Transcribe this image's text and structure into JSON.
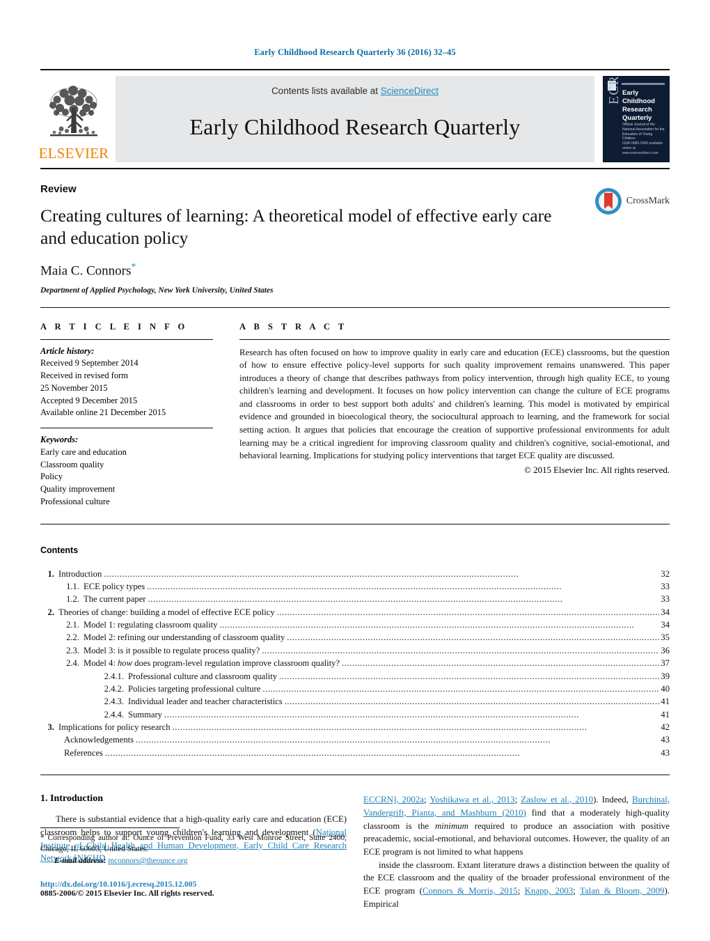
{
  "running_head": "Early Childhood Research Quarterly 36 (2016) 32–45",
  "banner": {
    "publisher_name": "ELSEVIER",
    "contents_prefix": "Contents lists available at ",
    "sciencedirect": "ScienceDirect",
    "journal_title": "Early Childhood Research Quarterly",
    "cover": {
      "title": "Early Childhood Research Quarterly",
      "subtitle": "Official Journal of the National Association for the Education of Young Children",
      "mark": "ECRQ",
      "footer": "ISSN 0885-2006  available online at www.sciencedirect.com"
    }
  },
  "article": {
    "type": "Review",
    "title": "Creating cultures of learning: A theoretical model of effective early care and education policy",
    "author": "Maia C. Connors",
    "author_marker": "*",
    "affiliation": "Department of Applied Psychology, New York University, United States",
    "crossmark_label": "CrossMark"
  },
  "info": {
    "heading": "A R T I C L E   I N F O",
    "history_head": "Article history:",
    "history": [
      "Received 9 September 2014",
      "Received in revised form",
      "25 November 2015",
      "Accepted 9 December 2015",
      "Available online 21 December 2015"
    ],
    "keywords_head": "Keywords:",
    "keywords": [
      "Early care and education",
      "Classroom quality",
      "Policy",
      "Quality improvement",
      "Professional culture"
    ]
  },
  "abstract": {
    "heading": "A B S T R A C T",
    "text": "Research has often focused on how to improve quality in early care and education (ECE) classrooms, but the question of how to ensure effective policy-level supports for such quality improvement remains unanswered. This paper introduces a theory of change that describes pathways from policy intervention, through high quality ECE, to young children's learning and development. It focuses on how policy intervention can change the culture of ECE programs and classrooms in order to best support both adults' and children's learning. This model is motivated by empirical evidence and grounded in bioecological theory, the sociocultural approach to learning, and the framework for social setting action. It argues that policies that encourage the creation of supportive professional environments for adult learning may be a critical ingredient for improving classroom quality and children's cognitive, social-emotional, and behavioral learning. Implications for studying policy interventions that target ECE quality are discussed.",
    "copyright": "© 2015 Elsevier Inc. All rights reserved."
  },
  "contents": {
    "heading": "Contents",
    "entries": [
      {
        "level": 1,
        "num": "1.",
        "label": "Introduction",
        "page": "32"
      },
      {
        "level": 2,
        "num": "1.1.",
        "label": "ECE policy types",
        "page": "33"
      },
      {
        "level": 2,
        "num": "1.2.",
        "label": "The current paper",
        "page": "33"
      },
      {
        "level": 1,
        "num": "2.",
        "label": "Theories of change: building a model of effective ECE policy",
        "page": "34"
      },
      {
        "level": 2,
        "num": "2.1.",
        "label": "Model 1: regulating classroom quality",
        "page": "34"
      },
      {
        "level": 2,
        "num": "2.2.",
        "label": "Model 2: refining our understanding of classroom quality",
        "page": "35"
      },
      {
        "level": 2,
        "num": "2.3.",
        "label": "Model 3: is it possible to regulate process quality?",
        "page": "36"
      },
      {
        "level": 2,
        "num": "2.4.",
        "label": "Model 4: how does program-level regulation improve classroom quality?",
        "page": "37"
      },
      {
        "level": 3,
        "num": "2.4.1.",
        "label": "Professional culture and classroom quality",
        "page": "39"
      },
      {
        "level": 3,
        "num": "2.4.2.",
        "label": "Policies targeting professional culture",
        "page": "40"
      },
      {
        "level": 3,
        "num": "2.4.3.",
        "label": "Individual leader and teacher characteristics",
        "page": "41"
      },
      {
        "level": 3,
        "num": "2.4.4.",
        "label": "Summary",
        "page": "41"
      },
      {
        "level": 1,
        "num": "3.",
        "label": "Implications for policy research",
        "page": "42"
      },
      {
        "level": 0,
        "num": "",
        "label": "Acknowledgements",
        "page": "43"
      },
      {
        "level": 0,
        "num": "",
        "label": "References",
        "page": "43"
      }
    ]
  },
  "body": {
    "section_heading": "1.  Introduction",
    "left_paragraph_plain_1": "There is substantial evidence that a high-quality early care and education (ECE) classroom helps to support young children's learning and development (",
    "left_citation_1": "National Institute of Child Health and Human Development, Early Child Care Research Network [NICHD",
    "right_citation_1": "ECCRN], 2002a",
    "right_sep_1": "; ",
    "right_citation_2": "Yoshikawa et al., 2013",
    "right_sep_2": "; ",
    "right_citation_3": "Zaslow et al., 2010",
    "right_plain_1": "). Indeed, ",
    "right_citation_4": "Burchinal, Vandergrift, Pianta, and Mashburn (2010)",
    "right_plain_2": " find that a moderately high-quality classroom is the ",
    "right_italic_1": "minimum",
    "right_plain_3": " required to produce an association with positive preacademic, social-emotional, and behavioral outcomes. However, the quality of an ECE program is not limited to what happens",
    "right_paragraph_2_plain_1": "inside the classroom. Extant literature draws a distinction between the quality of the ECE classroom and the quality of the broader professional environment of the ECE program (",
    "right_citation_5": "Connors & Morris, 2015",
    "right_sep_3": "; ",
    "right_citation_6": "Knapp, 2003",
    "right_sep_4": "; ",
    "right_citation_7": "Talan & Bloom, 2009",
    "right_plain_4": "). Empirical"
  },
  "footnote": {
    "marker": "*",
    "text": " Corresponding author at: Ounce of Prevention Fund, 33 West Monroe Street, Suite 2400, Chicago, IL 60603, United States.",
    "email_label": "E-mail address:",
    "email": "mconnors@theounce.org"
  },
  "footer": {
    "doi": "http://dx.doi.org/10.1016/j.ecresq.2015.12.005",
    "issn": "0885-2006/© 2015 Elsevier Inc. All rights reserved."
  },
  "colors": {
    "link": "#1f7fb8",
    "header_blue": "#0b6ba0",
    "elsevier_orange": "#ef8200",
    "banner_gray": "#e6e7e8",
    "cover_navy": "#0d1b33"
  }
}
